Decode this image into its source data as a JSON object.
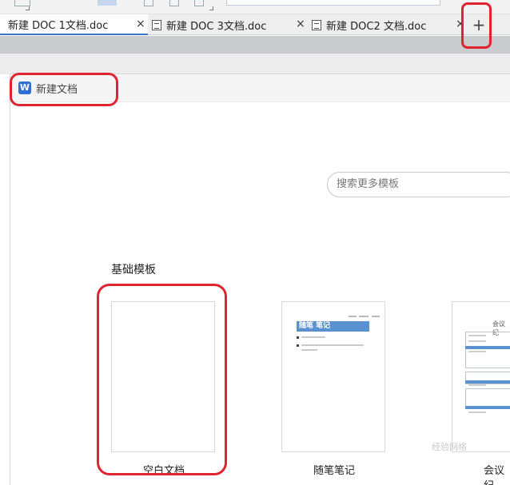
{
  "tabs": [
    {
      "title": "新建 DOC 1文档.doc",
      "active": true
    },
    {
      "title": "新建 DOC 3文档.doc",
      "active": false
    },
    {
      "title": "新建 DOC2 文档.doc",
      "active": false
    }
  ],
  "tab_close_glyph": "×",
  "add_tab_glyph": "+",
  "panel": {
    "logo_letter": "W",
    "title": "新建文档"
  },
  "search": {
    "placeholder": "搜索更多模板"
  },
  "section_title": "基础模板",
  "templates": [
    {
      "name": "空白文档"
    },
    {
      "name": "随笔笔记",
      "header": "随笔  笔记"
    },
    {
      "name": "会议纪",
      "header": "会议纪"
    }
  ],
  "watermark": "经验网络",
  "colors": {
    "accent": "#3b73c7",
    "highlight": "#e0242f",
    "template_blue": "#5a92cf"
  },
  "icons": [
    "document-icon",
    "close-icon",
    "plus-icon",
    "wps-writer-logo-icon"
  ]
}
